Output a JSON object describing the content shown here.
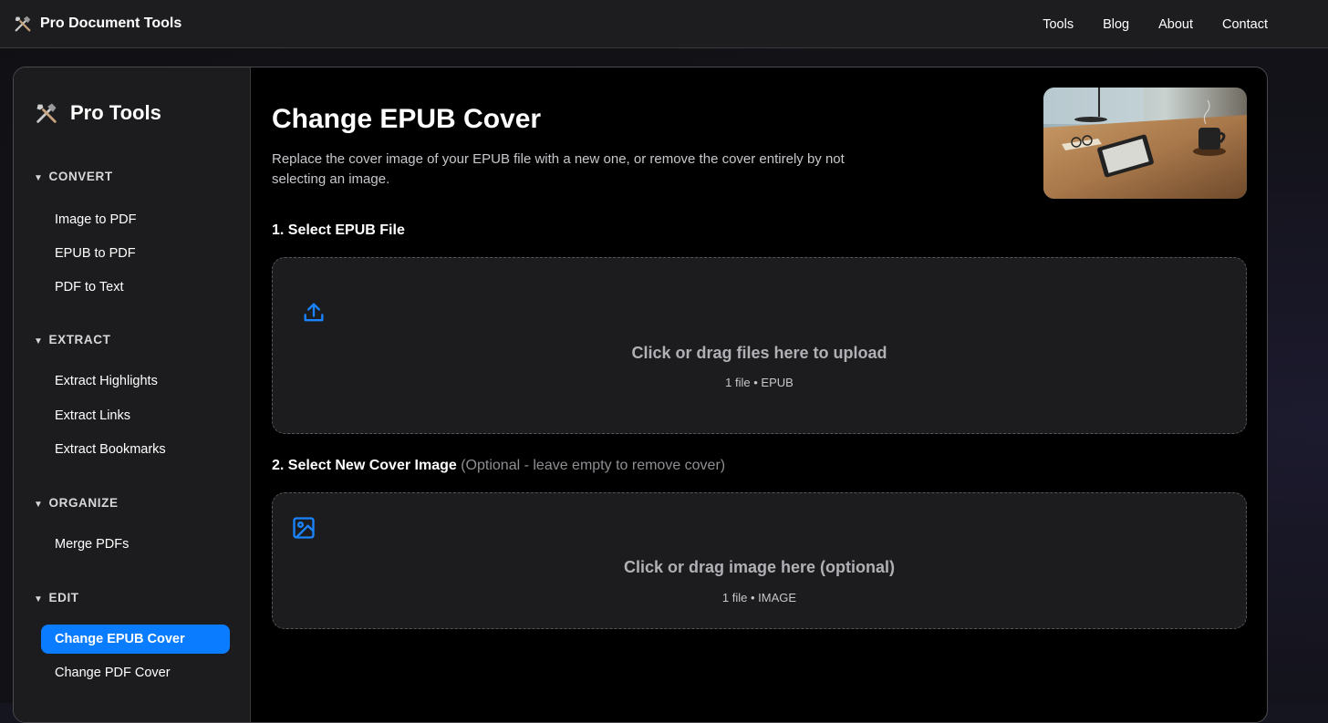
{
  "header": {
    "brand": "Pro Document Tools",
    "nav": [
      "Tools",
      "Blog",
      "About",
      "Contact"
    ]
  },
  "sidebar": {
    "title": "Pro Tools",
    "sections": [
      {
        "label": "CONVERT",
        "items": [
          "Image to PDF",
          "EPUB to PDF",
          "PDF to Text"
        ]
      },
      {
        "label": "EXTRACT",
        "items": [
          "Extract Highlights",
          "Extract Links",
          "Extract Bookmarks"
        ]
      },
      {
        "label": "ORGANIZE",
        "items": [
          "Merge PDFs"
        ]
      },
      {
        "label": "EDIT",
        "items": [
          "Change EPUB Cover",
          "Change PDF Cover"
        ]
      }
    ],
    "active_item": "Change EPUB Cover"
  },
  "main": {
    "title": "Change EPUB Cover",
    "description": "Replace the cover image of your EPUB file with a new one, or remove the cover entirely by not selecting an image.",
    "step1": {
      "label": "1. Select EPUB File",
      "dropzone_title": "Click or drag files here to upload",
      "dropzone_sub": "1 file • EPUB"
    },
    "step2": {
      "label": "2. Select New Cover Image",
      "hint": "(Optional - leave empty to remove cover)",
      "dropzone_title": "Click or drag image here (optional)",
      "dropzone_sub": "1 file • IMAGE"
    }
  },
  "icons": {
    "brand": "tools-icon",
    "upload": "upload-icon",
    "image": "image-icon"
  },
  "colors": {
    "accent": "#0a7cff",
    "icon_blue": "#1a84ff"
  }
}
